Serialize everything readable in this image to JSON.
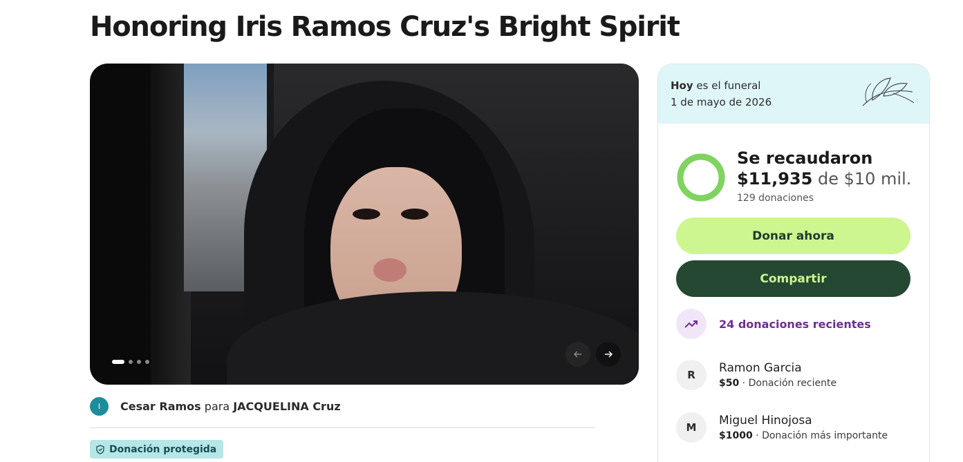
{
  "page": {
    "title": "Honoring Iris Ramos Cruz's Bright Spirit"
  },
  "media": {
    "image_alt": "Photo of Iris Ramos Cruz",
    "slide_count": 4,
    "active_slide": 1,
    "prev_icon": "arrow-left-icon",
    "next_icon": "arrow-right-icon"
  },
  "organizer": {
    "avatar_initial": "I",
    "name": "Cesar Ramos",
    "connector": "para",
    "beneficiary": "JACQUELINA Cruz"
  },
  "protection": {
    "icon": "shield-icon",
    "label": "Donación protegida"
  },
  "funeral": {
    "today_label": "Hoy",
    "suffix": "es el funeral",
    "date": "1 de mayo de 2026",
    "icon": "leaf-illustration-icon"
  },
  "fundraiser": {
    "raised_label": "Se recaudaron",
    "amount": "$11,935",
    "connector": "de",
    "goal": "$10 mil.",
    "donations_count": "129 donaciones",
    "progress_fraction": 1.0,
    "progress_color": "#7fd35f"
  },
  "actions": {
    "donate_label": "Donar ahora",
    "share_label": "Compartir"
  },
  "recent": {
    "icon": "trending-up-icon",
    "label": "24 donaciones recientes"
  },
  "donors": [
    {
      "initial": "R",
      "name": "Ramon Garcia",
      "amount": "$50",
      "note": "Donación reciente"
    },
    {
      "initial": "M",
      "name": "Miguel Hinojosa",
      "amount": "$1000",
      "note": "Donación más importante"
    }
  ],
  "colors": {
    "accent_green": "#cdf590",
    "dark_green": "#254832",
    "funeral_bg": "#def6f8",
    "recent_purple": "#6e2e8f",
    "protected_bg": "#b6e6e6"
  }
}
